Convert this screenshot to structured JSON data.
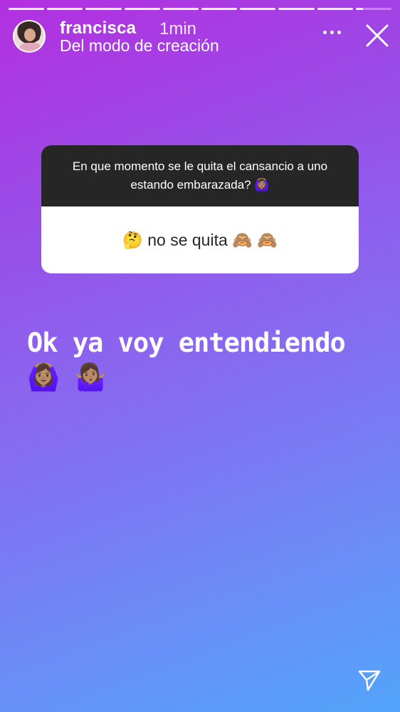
{
  "story": {
    "username": "francisca",
    "time": "1min",
    "subtitle": "Del modo de creación",
    "segments": 10,
    "current_segment": 10
  },
  "question_sticker": {
    "question": "En que momento se le quita el cansancio a uno estando embarazada? 🙆🏽‍♀️",
    "answer": "🤔 no se quita 🙈 🙈"
  },
  "caption": "Ok ya voy entendiendo 🙆🏽‍♀️ 🤷🏽‍♀️",
  "icons": {
    "more": "more-options-icon",
    "close": "close-icon",
    "send": "send-icon"
  }
}
